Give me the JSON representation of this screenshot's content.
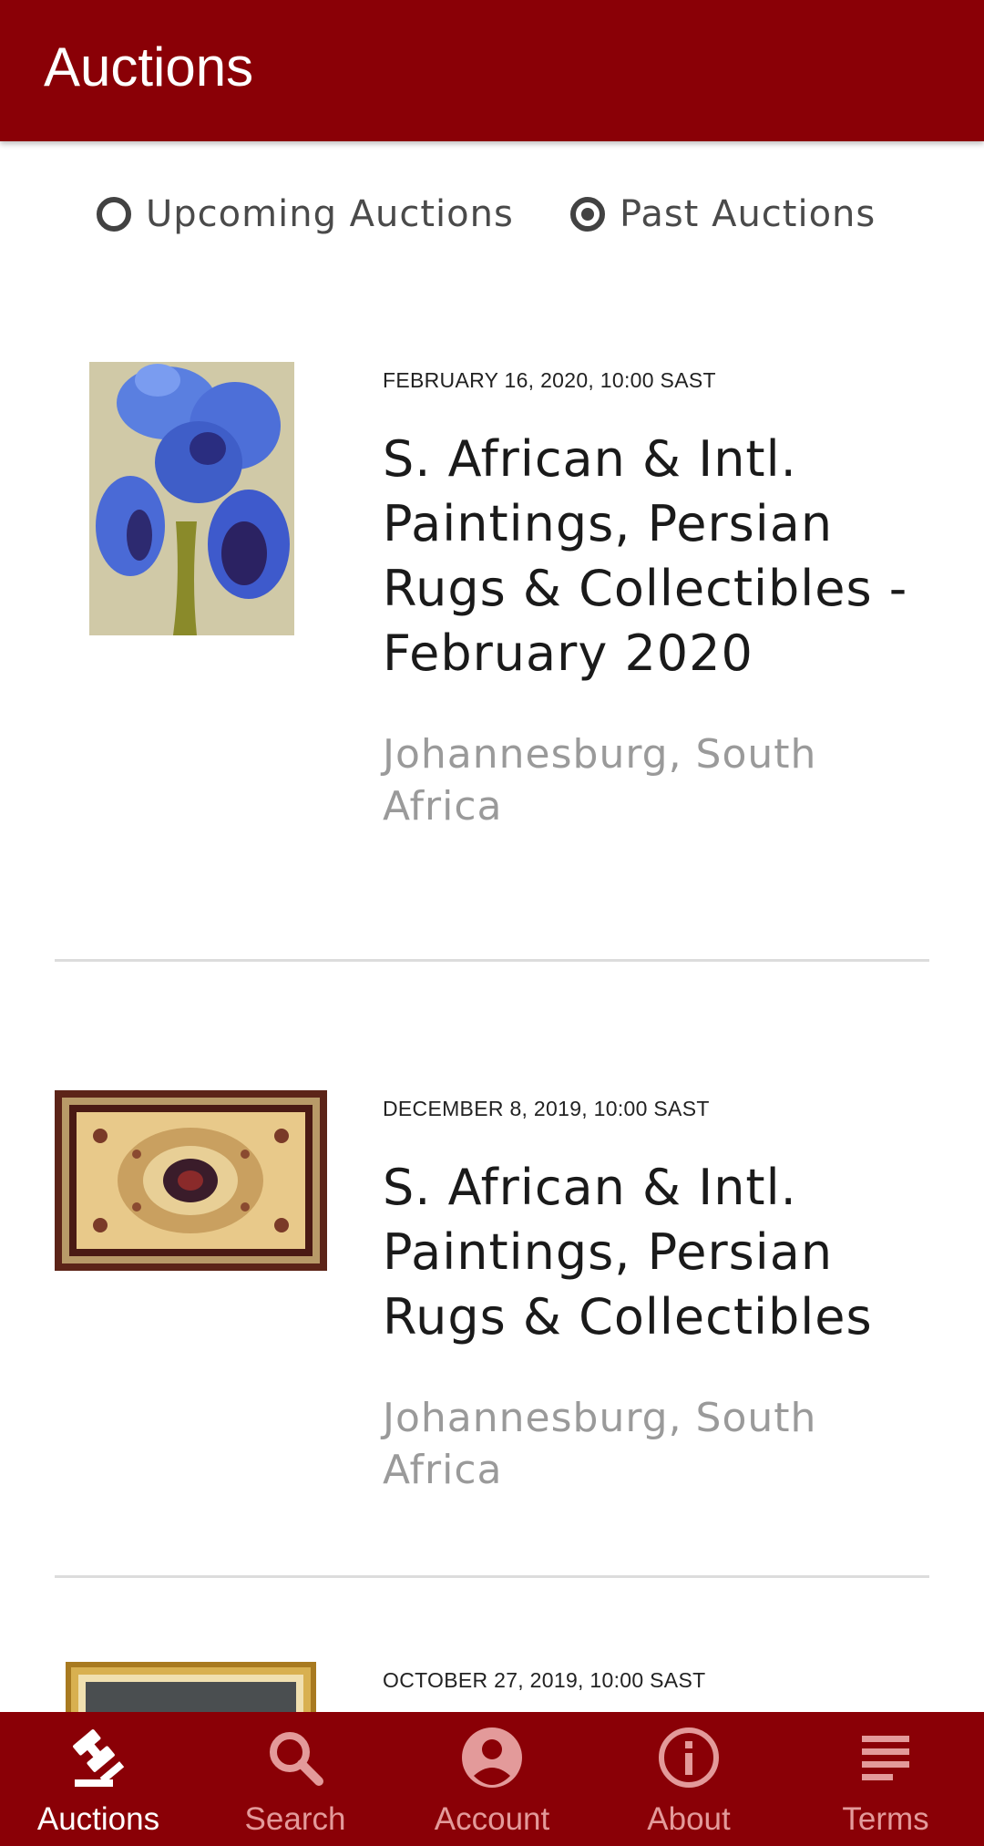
{
  "app_bar": {
    "title": "Auctions"
  },
  "filter": {
    "options": [
      {
        "label": "Upcoming Auctions",
        "selected": false
      },
      {
        "label": "Past Auctions",
        "selected": true
      }
    ]
  },
  "auctions": [
    {
      "date": "FEBRUARY 16, 2020, 10:00 SAST",
      "title": "S. African & Intl. Paintings, Persian Rugs & Collectibles - February 2020",
      "location": "Johannesburg, South Africa",
      "image": "iris-painting"
    },
    {
      "date": "DECEMBER 8, 2019, 10:00 SAST",
      "title": "S. African & Intl. Paintings, Persian Rugs & Collectibles",
      "location": "Johannesburg, South Africa",
      "image": "persian-rug"
    },
    {
      "date": "OCTOBER 27, 2019, 10:00 SAST",
      "image": "framed-painting"
    }
  ],
  "bottom_nav": {
    "items": [
      {
        "label": "Auctions",
        "icon": "gavel-icon",
        "active": true
      },
      {
        "label": "Search",
        "icon": "search-icon",
        "active": false
      },
      {
        "label": "Account",
        "icon": "account-icon",
        "active": false
      },
      {
        "label": "About",
        "icon": "info-icon",
        "active": false
      },
      {
        "label": "Terms",
        "icon": "terms-icon",
        "active": false
      }
    ]
  },
  "colors": {
    "primary": "#8a0006",
    "nav_inactive": "#e39a9a",
    "nav_active": "#ffffff",
    "location_text": "#9a9a9a"
  }
}
